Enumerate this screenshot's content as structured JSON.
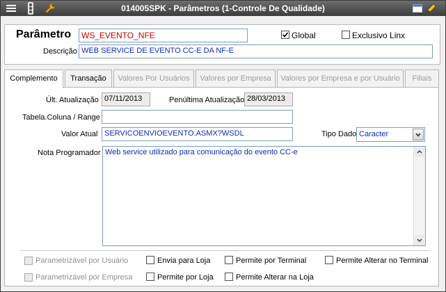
{
  "window": {
    "title": "014005SPK - Parâmetros (1-Controle De Qualidade)"
  },
  "header": {
    "parametro_label": "Parâmetro",
    "parametro_value": "WS_EVENTO_NFE",
    "global_label": "Global",
    "global_checked": true,
    "exclusivo_label": "Exclusivo Linx",
    "exclusivo_checked": false,
    "descricao_label": "Descrição",
    "descricao_value": "WEB SERVICE DE EVENTO CC-E DA NF-E"
  },
  "tabs": [
    {
      "label": "Complemento"
    },
    {
      "label": "Transação"
    },
    {
      "label": "Valores Por Usuários"
    },
    {
      "label": "Valores por Empresa"
    },
    {
      "label": "Valores por Empresa e por Usuário"
    },
    {
      "label": "Filiais"
    }
  ],
  "complemento": {
    "ult_atualizacao_label": "Últ. Atualização",
    "ult_atualizacao_value": "07/11/2013",
    "penultima_label": "Penúltima Atualização",
    "penultima_value": "28/03/2013",
    "tabela_label": "Tabela.Coluna / Range",
    "tabela_value": "",
    "valor_atual_label": "Valor Atual",
    "valor_atual_value": "SERVICOENVIOEVENTO.ASMX?WSDL",
    "tipo_dado_label": "Tipo Dado",
    "tipo_dado_value": "Caracter",
    "nota_label": "Nota Programador",
    "nota_value": "Web service utilizado para comunicação do evento CC-e"
  },
  "options": {
    "param_usuario": "Parametrizável por Usuário",
    "param_empresa": "Parametrizável por Empresa",
    "envia_loja": "Envia para Loja",
    "permite_loja": "Permite por Loja",
    "permite_terminal": "Permite por Terminal",
    "permite_alterar_loja": "Permite Alterar na Loja",
    "permite_alterar_terminal": "Permite Alterar no Terminal"
  }
}
